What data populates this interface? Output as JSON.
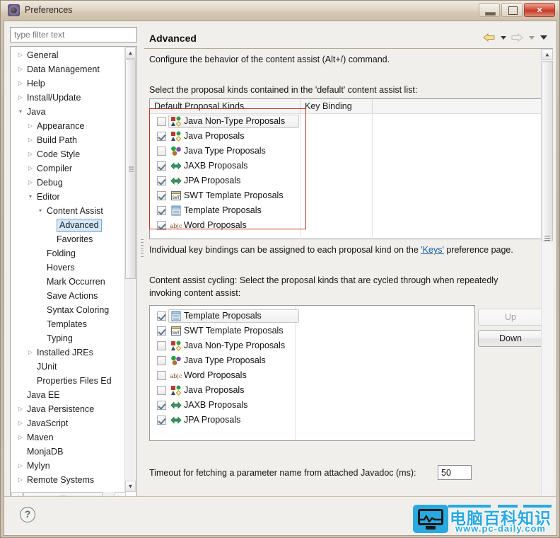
{
  "window": {
    "title": "Preferences",
    "icon": "preferences-gear-icon",
    "buttons": {
      "minimize": "minimize",
      "restore": "restore",
      "close": "×"
    }
  },
  "sidebar": {
    "filter_placeholder": "type filter text",
    "filter_value": "",
    "items": [
      {
        "label": "General",
        "indent": 0,
        "arrow": "collapsed"
      },
      {
        "label": "Data Management",
        "indent": 0,
        "arrow": "collapsed"
      },
      {
        "label": "Help",
        "indent": 0,
        "arrow": "collapsed"
      },
      {
        "label": "Install/Update",
        "indent": 0,
        "arrow": "collapsed"
      },
      {
        "label": "Java",
        "indent": 0,
        "arrow": "expanded"
      },
      {
        "label": "Appearance",
        "indent": 1,
        "arrow": "collapsed"
      },
      {
        "label": "Build Path",
        "indent": 1,
        "arrow": "collapsed"
      },
      {
        "label": "Code Style",
        "indent": 1,
        "arrow": "collapsed"
      },
      {
        "label": "Compiler",
        "indent": 1,
        "arrow": "collapsed"
      },
      {
        "label": "Debug",
        "indent": 1,
        "arrow": "collapsed"
      },
      {
        "label": "Editor",
        "indent": 1,
        "arrow": "expanded"
      },
      {
        "label": "Content Assist",
        "indent": 2,
        "arrow": "expanded"
      },
      {
        "label": "Advanced",
        "indent": 3,
        "arrow": "none",
        "selected": true
      },
      {
        "label": "Favorites",
        "indent": 3,
        "arrow": "none"
      },
      {
        "label": "Folding",
        "indent": 2,
        "arrow": "none"
      },
      {
        "label": "Hovers",
        "indent": 2,
        "arrow": "none"
      },
      {
        "label": "Mark Occurren",
        "indent": 2,
        "arrow": "none"
      },
      {
        "label": "Save Actions",
        "indent": 2,
        "arrow": "none"
      },
      {
        "label": "Syntax Coloring",
        "indent": 2,
        "arrow": "none"
      },
      {
        "label": "Templates",
        "indent": 2,
        "arrow": "none"
      },
      {
        "label": "Typing",
        "indent": 2,
        "arrow": "none"
      },
      {
        "label": "Installed JREs",
        "indent": 1,
        "arrow": "collapsed"
      },
      {
        "label": "JUnit",
        "indent": 1,
        "arrow": "none"
      },
      {
        "label": "Properties Files Ed",
        "indent": 1,
        "arrow": "none"
      },
      {
        "label": "Java EE",
        "indent": 0,
        "arrow": "none"
      },
      {
        "label": "Java Persistence",
        "indent": 0,
        "arrow": "collapsed"
      },
      {
        "label": "JavaScript",
        "indent": 0,
        "arrow": "collapsed"
      },
      {
        "label": "Maven",
        "indent": 0,
        "arrow": "collapsed"
      },
      {
        "label": "MonjaDB",
        "indent": 0,
        "arrow": "none"
      },
      {
        "label": "Mylyn",
        "indent": 0,
        "arrow": "collapsed"
      },
      {
        "label": "Remote Systems",
        "indent": 0,
        "arrow": "collapsed"
      }
    ]
  },
  "page": {
    "title": "Advanced",
    "nav": {
      "back_icon": "back-arrow-icon",
      "back_menu_icon": "chevron-down-icon",
      "forward_icon": "forward-arrow-icon",
      "forward_menu_icon": "chevron-down-icon",
      "menu_icon": "chevron-down-icon"
    },
    "description": "Configure the behavior of the content assist (Alt+/) command.",
    "default_section_label": "Select the proposal kinds contained in the 'default' content assist list:",
    "default_table": {
      "columns": [
        "Default Proposal Kinds",
        "Key Binding",
        ""
      ],
      "rows": [
        {
          "label": "Java Non-Type Proposals",
          "checked": false,
          "icon": "java-non-type-proposals-icon",
          "key_binding": "",
          "selected": true
        },
        {
          "label": "Java Proposals",
          "checked": true,
          "icon": "java-proposals-icon",
          "key_binding": ""
        },
        {
          "label": "Java Type Proposals",
          "checked": false,
          "icon": "java-type-proposals-icon",
          "key_binding": ""
        },
        {
          "label": "JAXB Proposals",
          "checked": true,
          "icon": "jaxb-proposals-icon",
          "key_binding": ""
        },
        {
          "label": "JPA Proposals",
          "checked": true,
          "icon": "jpa-proposals-icon",
          "key_binding": ""
        },
        {
          "label": "SWT Template Proposals",
          "checked": true,
          "icon": "swt-template-proposals-icon",
          "key_binding": ""
        },
        {
          "label": "Template Proposals",
          "checked": true,
          "icon": "template-proposals-icon",
          "key_binding": ""
        },
        {
          "label": "Word Proposals",
          "checked": true,
          "icon": "word-proposals-icon",
          "key_binding": ""
        }
      ]
    },
    "keybinding_note_prefix": "Individual key bindings can be assigned to each proposal kind on the ",
    "keybinding_link": "'Keys'",
    "keybinding_note_suffix": " preference page.",
    "cycling_label_line1": "Content assist cycling: Select the proposal kinds that are cycled through when repeatedly",
    "cycling_label_line2": "invoking content assist:",
    "cycling_table": {
      "rows": [
        {
          "label": "Template Proposals",
          "checked": true,
          "icon": "template-proposals-icon",
          "selected": true
        },
        {
          "label": "SWT Template Proposals",
          "checked": true,
          "icon": "swt-template-proposals-icon"
        },
        {
          "label": "Java Non-Type Proposals",
          "checked": false,
          "icon": "java-non-type-proposals-icon"
        },
        {
          "label": "Java Type Proposals",
          "checked": false,
          "icon": "java-type-proposals-icon"
        },
        {
          "label": "Word Proposals",
          "checked": false,
          "icon": "word-proposals-icon"
        },
        {
          "label": "Java Proposals",
          "checked": false,
          "icon": "java-proposals-icon"
        },
        {
          "label": "JAXB Proposals",
          "checked": true,
          "icon": "jaxb-proposals-icon"
        },
        {
          "label": "JPA Proposals",
          "checked": true,
          "icon": "jpa-proposals-icon"
        }
      ]
    },
    "up_button": "Up",
    "down_button": "Down",
    "timeout_label": "Timeout for fetching a parameter name from attached Javadoc (ms):",
    "timeout_value": "50"
  },
  "footer": {
    "help_icon": "help-question-icon",
    "help_glyph": "?"
  },
  "watermark": {
    "text_cn": "电脑百科知识",
    "url": "www.pc-daily.com",
    "color": "#29a9e0"
  },
  "annotation": {
    "highlight_color": "#c0392b"
  }
}
